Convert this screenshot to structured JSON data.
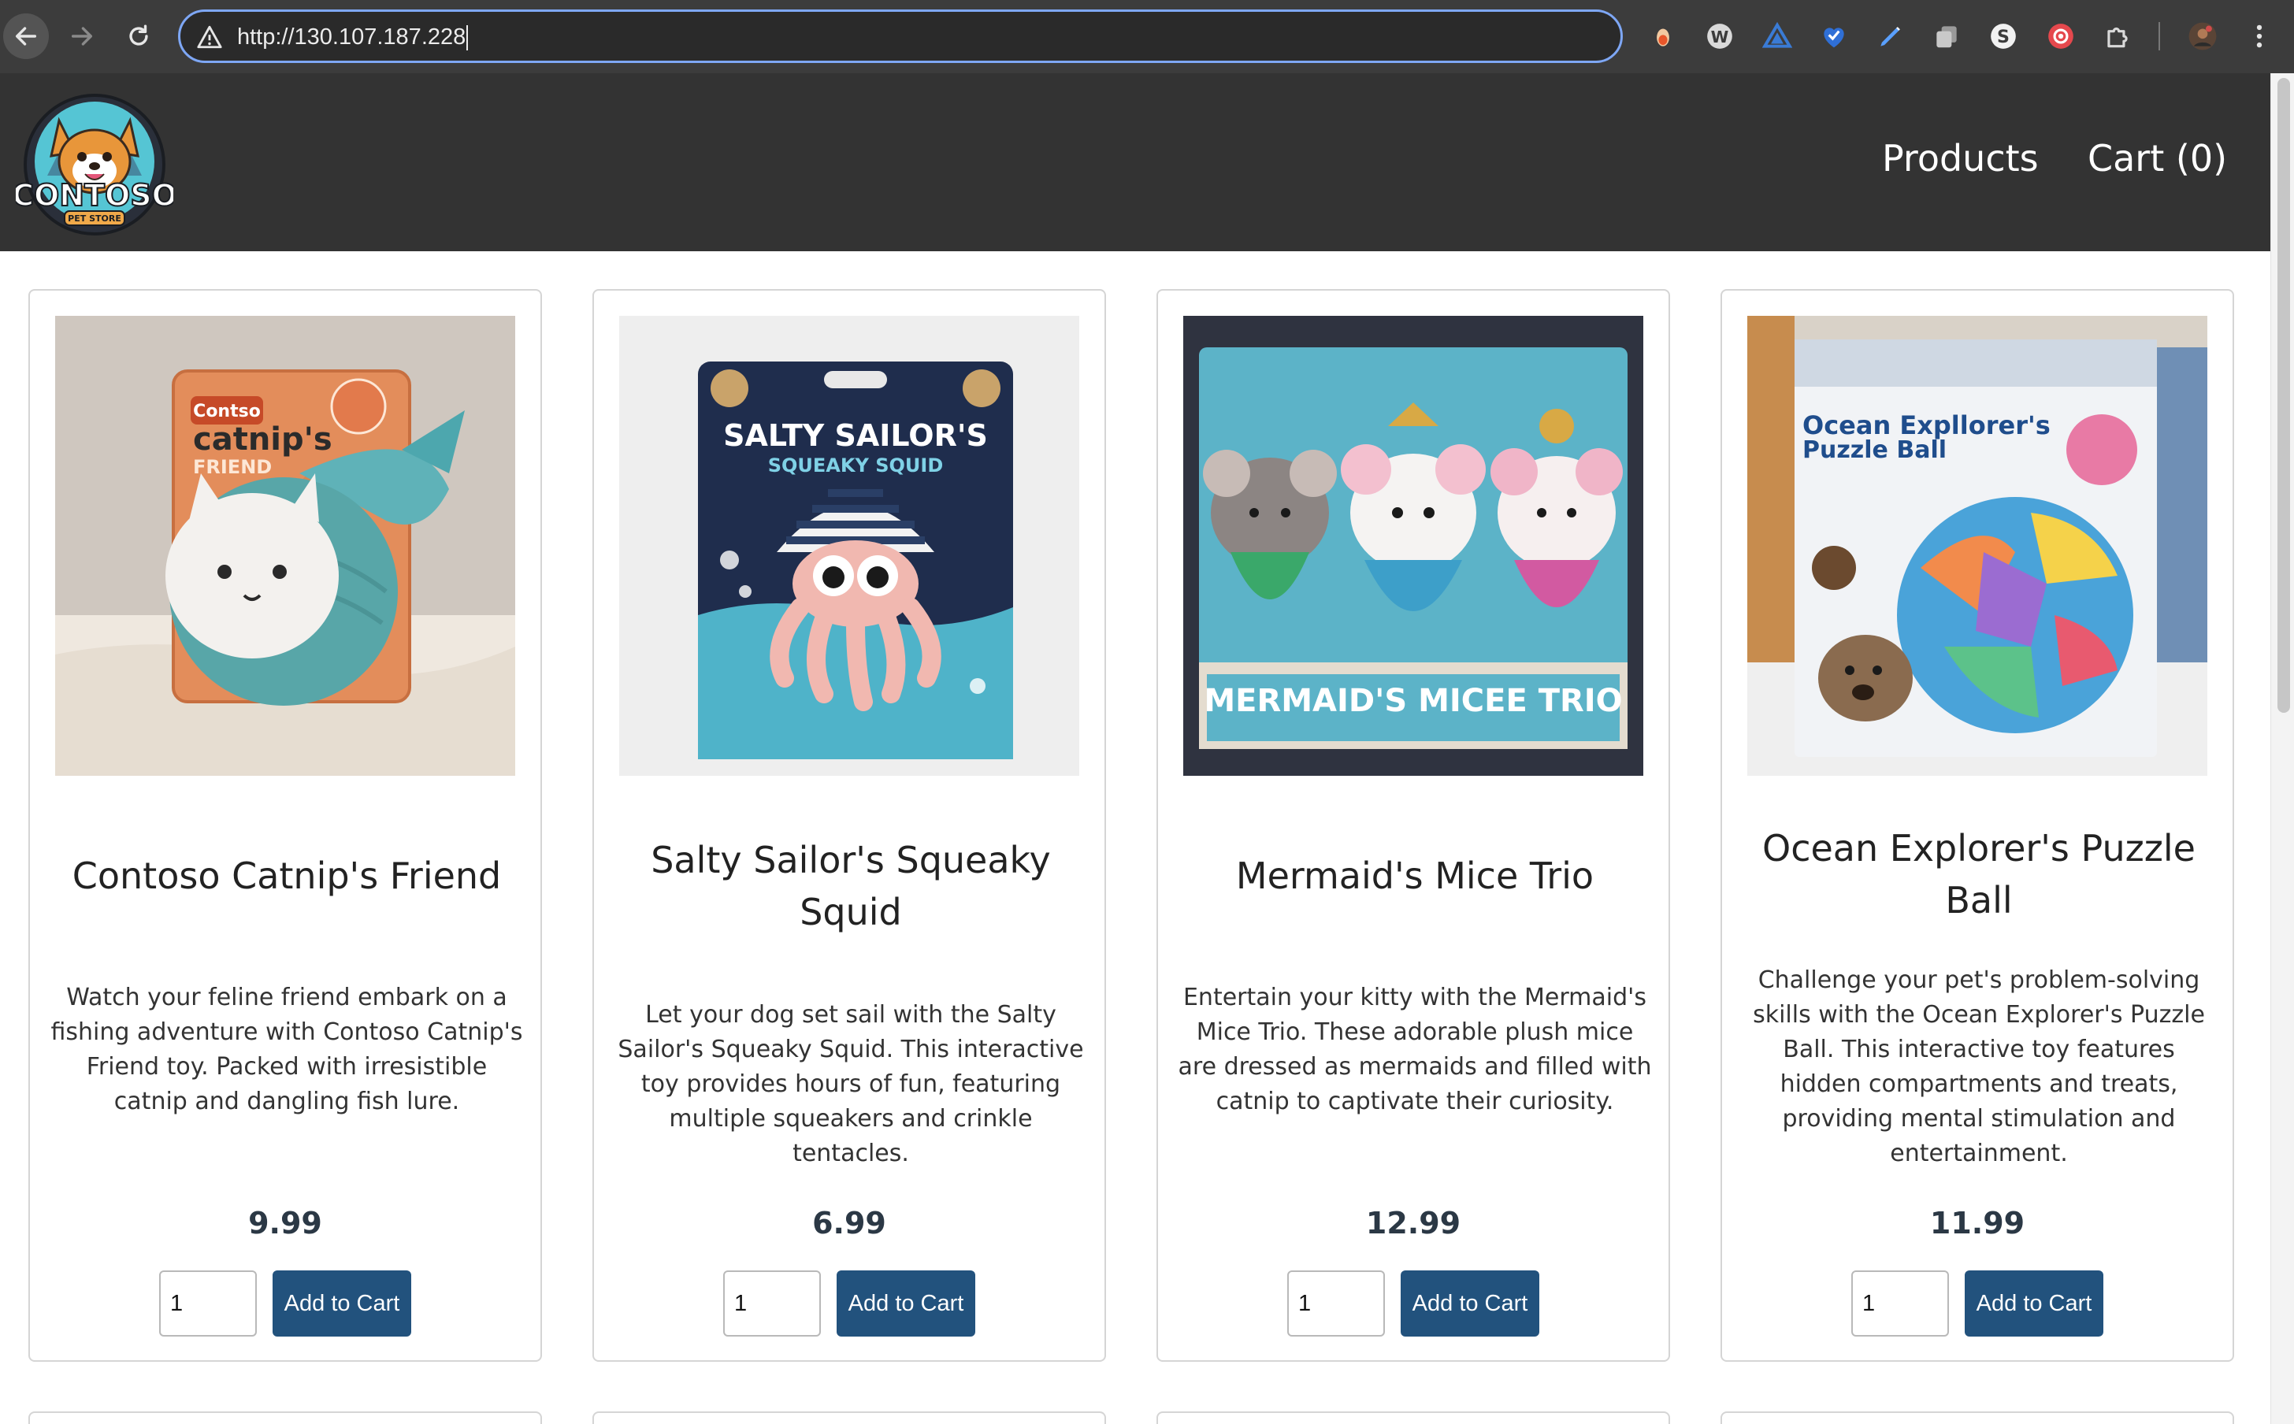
{
  "browser": {
    "url": "http://130.107.187.228",
    "extensions": [
      "honey-icon",
      "w-extension-icon",
      "triangle-extension-icon",
      "shield-heart-icon",
      "pen-icon",
      "copy-icon",
      "s-extension-icon",
      "camera-extension-icon",
      "puzzle-icon"
    ]
  },
  "store": {
    "logo_text": "CONTOSO",
    "logo_subtext": "PET STORE",
    "nav": {
      "products": "Products",
      "cart": "Cart (0)"
    },
    "brand_button_color": "#22527d",
    "header_color": "#333333"
  },
  "products": [
    {
      "name": "Contoso Catnip's Friend",
      "description": "Watch your feline friend embark on a fishing adventure with Contoso Catnip's Friend toy. Packed with irresistible catnip and dangling fish lure.",
      "price": "9.99",
      "quantity": "1",
      "button": "Add to Cart",
      "package_brand": "Contso",
      "package_title": "catnip's",
      "package_subtitle": "FRIEND"
    },
    {
      "name": "Salty Sailor's Squeaky Squid",
      "description": "Let your dog set sail with the Salty Sailor's Squeaky Squid. This interactive toy provides hours of fun, featuring multiple squeakers and crinkle tentacles.",
      "price": "6.99",
      "quantity": "1",
      "button": "Add to Cart",
      "package_title": "SALTY SAILOR'S",
      "package_subtitle": "SQUEAKY SQUID"
    },
    {
      "name": "Mermaid's Mice Trio",
      "description": "Entertain your kitty with the Mermaid's Mice Trio. These adorable plush mice are dressed as mermaids and filled with catnip to captivate their curiosity.",
      "price": "12.99",
      "quantity": "1",
      "button": "Add to Cart",
      "package_title": "MERMAID'S MICEE TRIO"
    },
    {
      "name": "Ocean Explorer's Puzzle Ball",
      "description": "Challenge your pet's problem-solving skills with the Ocean Explorer's Puzzle Ball. This interactive toy features hidden compartments and treats, providing mental stimulation and entertainment.",
      "price": "11.99",
      "quantity": "1",
      "button": "Add to Cart",
      "package_title": "Ocean Expllorer's",
      "package_subtitle": "Puzzle Ball"
    }
  ]
}
